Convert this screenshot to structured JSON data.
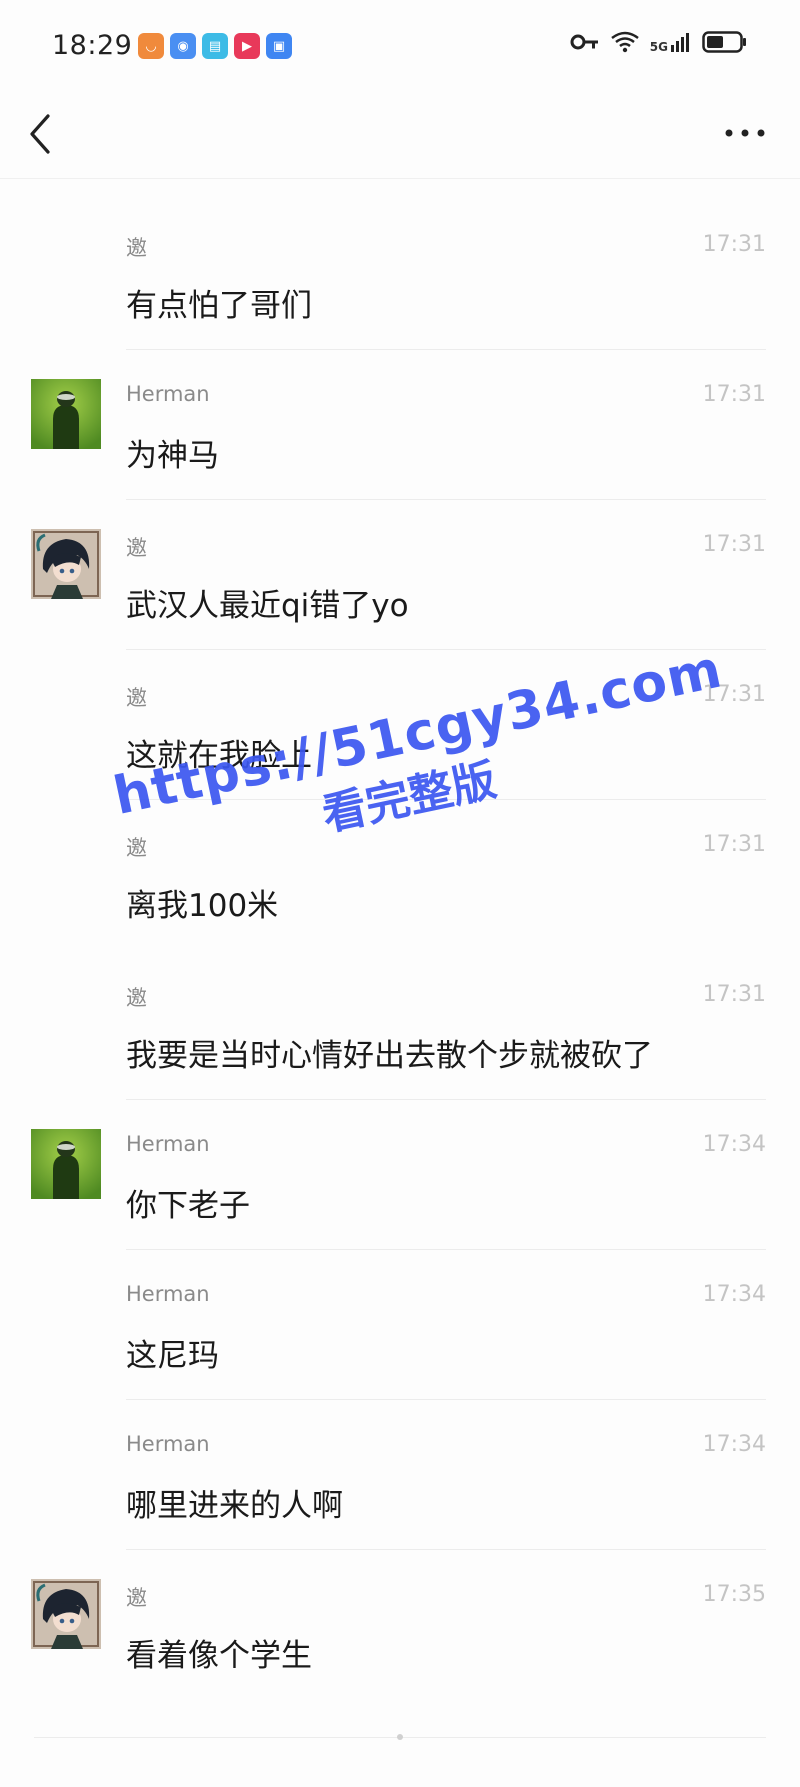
{
  "status_bar": {
    "time": "18:29",
    "network": "5G",
    "icons": [
      "taobao-icon",
      "browser-icon",
      "reader-icon",
      "video-icon",
      "wallet-icon"
    ],
    "icon_colors": [
      "#f08a3c",
      "#4a8ff2",
      "#3dbbe6",
      "#e8395a",
      "#3f86f2"
    ]
  },
  "nav": {
    "back_icon": "chevron-left-icon",
    "more_icon": "more-horizontal-icon"
  },
  "messages": [
    {
      "name": "邀",
      "time": "17:31",
      "text": "有点怕了哥们",
      "avatar": "none"
    },
    {
      "name": "Herman",
      "time": "17:31",
      "text": "为神马",
      "avatar": "herman"
    },
    {
      "name": "邀",
      "time": "17:31",
      "text": "武汉人最近qi错了yo",
      "avatar": "anime"
    },
    {
      "name": "邀",
      "time": "17:31",
      "text": "这就在我脸上",
      "avatar": "none"
    },
    {
      "name": "邀",
      "time": "17:31",
      "text": "离我100米",
      "avatar": "none"
    },
    {
      "name": "邀",
      "time": "17:31",
      "text": "我要是当时心情好出去散个步就被砍了",
      "avatar": "none"
    },
    {
      "name": "Herman",
      "time": "17:34",
      "text": "你下老子",
      "avatar": "herman"
    },
    {
      "name": "Herman",
      "time": "17:34",
      "text": "这尼玛",
      "avatar": "none"
    },
    {
      "name": "Herman",
      "time": "17:34",
      "text": "哪里进来的人啊",
      "avatar": "none"
    },
    {
      "name": "邀",
      "time": "17:35",
      "text": "看着像个学生",
      "avatar": "anime"
    }
  ],
  "watermark": {
    "line1": "https://51cgy34.com",
    "line2": "看完整版",
    "color": "#3b57f0"
  }
}
